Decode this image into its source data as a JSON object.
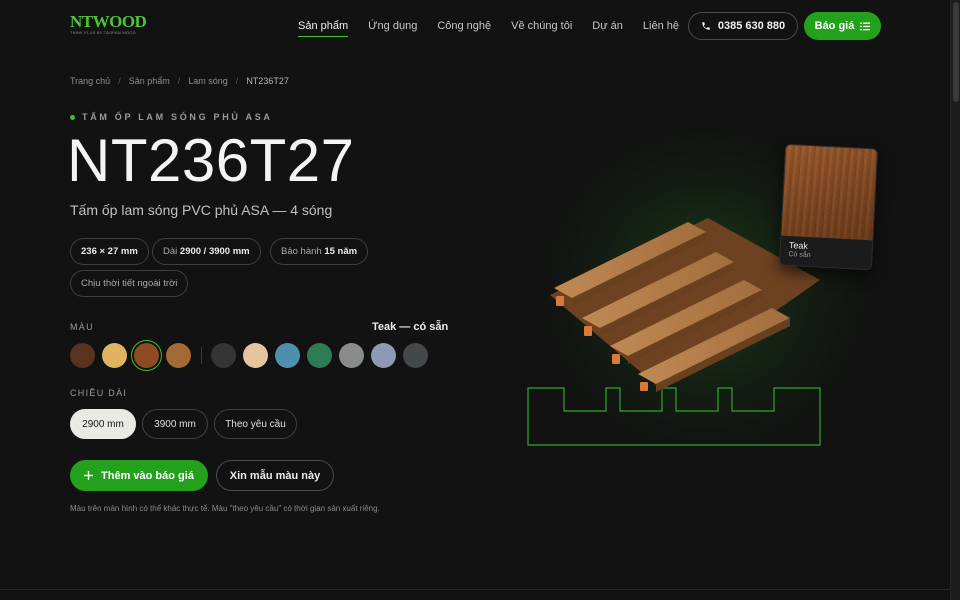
{
  "brand": {
    "logo_text": "NTWOOD",
    "logo_tagline": "THINK PLUS BY TAOPAN WOOD"
  },
  "nav": {
    "items": [
      {
        "label": "Sản phẩm",
        "active": true
      },
      {
        "label": "Ứng dụng",
        "active": false
      },
      {
        "label": "Công nghệ",
        "active": false
      },
      {
        "label": "Về chúng tôi",
        "active": false
      },
      {
        "label": "Dự án",
        "active": false
      },
      {
        "label": "Liên hệ",
        "active": false
      }
    ],
    "phone": "0385 630 880",
    "phone_icon": "phone-icon",
    "quote_label": "Báo giá",
    "quote_icon": "list-icon"
  },
  "breadcrumb": {
    "items": [
      "Trang chủ",
      "Sản phẩm",
      "Lam sóng",
      "NT236T27"
    ],
    "separator": "/"
  },
  "product": {
    "eyebrow": "TẤM ỐP LAM SÓNG PHỦ ASA",
    "code": "NT236T27",
    "subtitle": "Tấm ốp lam sóng PVC phủ ASA — 4 sóng",
    "specs": [
      {
        "prefix": "",
        "value": "236 × 27 mm"
      },
      {
        "prefix": "Dài ",
        "value": "2900 / 3900 mm"
      },
      {
        "prefix": "Bảo hành ",
        "value": "15 năm"
      },
      {
        "prefix": "Chịu thời tiết ngoài trời",
        "value": ""
      }
    ]
  },
  "color": {
    "label": "MÀU",
    "status": "Teak — có sẵn",
    "swatches": [
      {
        "name": "walnut",
        "hex": "#5a3220"
      },
      {
        "name": "oak",
        "hex": "#e0b360"
      },
      {
        "name": "teak",
        "hex": "#8e4a22",
        "selected": true
      },
      {
        "name": "golden-oak",
        "hex": "#a36a35"
      },
      {
        "name": "charcoal",
        "hex": "#353535"
      },
      {
        "name": "cream",
        "hex": "#e6c49e"
      },
      {
        "name": "sky-blue",
        "hex": "#4f8fae"
      },
      {
        "name": "jade",
        "hex": "#2f7a55"
      },
      {
        "name": "silver",
        "hex": "#8a8b8b"
      },
      {
        "name": "steel-blue",
        "hex": "#8d9ab5"
      },
      {
        "name": "graphite",
        "hex": "#444849"
      }
    ]
  },
  "length": {
    "label": "CHIỀU DÀI",
    "options": [
      {
        "label": "2900 mm",
        "selected": true
      },
      {
        "label": "3900 mm",
        "selected": false
      },
      {
        "label": "Theo yêu cầu",
        "selected": false
      }
    ]
  },
  "actions": {
    "primary_label": "Thêm vào báo giá",
    "primary_icon": "plus-icon",
    "secondary_label": "Xin mẫu màu này"
  },
  "footnote": "Màu trên màn hình có thể khác thực tế. Màu \"theo yêu cầu\" có thời gian sản xuất riêng.",
  "sample_card": {
    "name": "Teak",
    "stock": "Có sẵn"
  },
  "colors": {
    "accent": "#24a11c",
    "background": "#111211"
  }
}
